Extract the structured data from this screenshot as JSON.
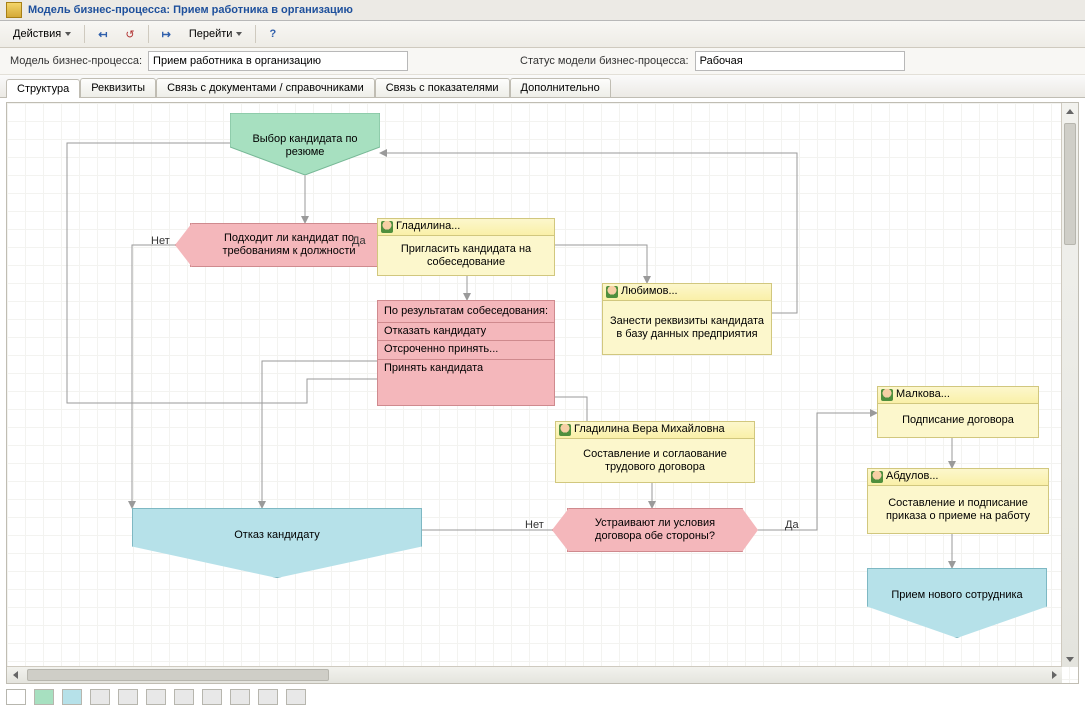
{
  "window": {
    "title": "Модель бизнес-процесса: Прием работника в организацию"
  },
  "toolbar": {
    "actions": "Действия",
    "goto": "Перейти"
  },
  "fieldrow": {
    "model_label": "Модель бизнес-процесса:",
    "model_value": "Прием работника в организацию",
    "status_label": "Статус модели бизнес-процесса:",
    "status_value": "Рабочая"
  },
  "tabs": {
    "t0": "Структура",
    "t1": "Реквизиты",
    "t2": "Связь с документами / справочниками",
    "t3": "Связь с показателями",
    "t4": "Дополнительно"
  },
  "diagram": {
    "start": "Выбор кандидата по резюме",
    "dec1": "Подходит ли кандидат по требованиям к должности",
    "dec1_no": "Нет",
    "dec1_yes": "Да",
    "task_invite_header": "Гладилина...",
    "task_invite_body": "Пригласить кандидата на собеседование",
    "switch_title": "По результатам собеседования:",
    "switch_opt1": "Отказать кандидату",
    "switch_opt2": "Отсроченно принять...",
    "switch_opt3": "Принять кандидата",
    "task_db_header": "Любимов...",
    "task_db_body": "Занести реквизиты кандидата в базу данных предприятия",
    "task_draft_header": "Гладилина Вера Михайловна",
    "task_draft_body": "Составление и соглаование трудового договора",
    "dec2": "Устраивают ли условия договора обе стороны?",
    "dec2_no": "Нет",
    "dec2_yes": "Да",
    "task_sign_header": "Малкова...",
    "task_sign_body": "Подписание договора",
    "task_order_header": "Абдулов...",
    "task_order_body": "Составление и подписание приказа о приеме на работу",
    "term_reject": "Отказ кандидату",
    "term_accept": "Прием нового сотрудника"
  }
}
